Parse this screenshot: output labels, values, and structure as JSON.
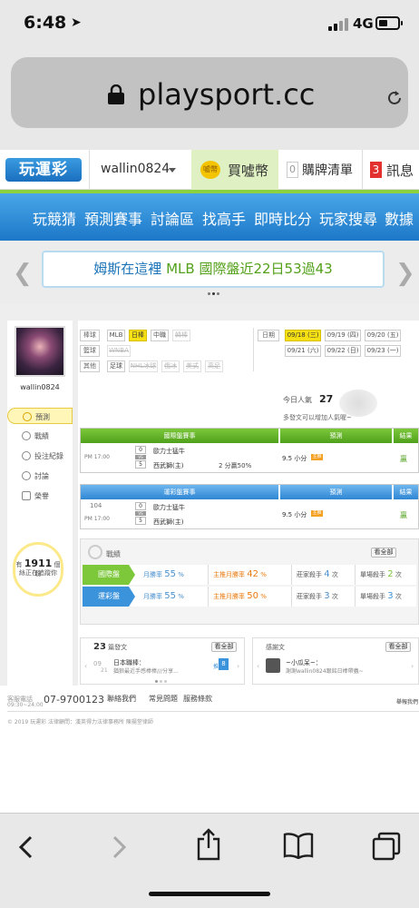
{
  "status_bar": {
    "time": "6:48",
    "network": "4G"
  },
  "address_bar": {
    "url": "playsport.cc"
  },
  "site_header": {
    "logo_text": "玩運彩",
    "username": "wallin0824",
    "buy_coins_label": "買噓幣",
    "coin_icon_text": "噓幣",
    "cart_count": "0",
    "cart_label": "購牌清單",
    "message_count": "3",
    "message_label": "訊息"
  },
  "nav": {
    "items": [
      "玩競猜",
      "預測賽事",
      "討論區",
      "找高手",
      "即時比分",
      "玩家搜尋",
      "數據"
    ]
  },
  "banner": {
    "prefix": "姆斯在這裡",
    "highlight": " MLB 國際盤近22日53過43"
  },
  "sidebar": {
    "username": "wallin0824",
    "menu": [
      "預測",
      "戰績",
      "投注紀錄",
      "討論",
      "榮譽"
    ],
    "count_prefix": "有",
    "count": "1911",
    "count_unit": "個粉",
    "count_suffix": "絲正在追蹤你"
  },
  "filters": {
    "baseball_label": "棒球",
    "baseball": [
      "MLB",
      "日棒",
      "中職",
      "韓棒"
    ],
    "basketball_label": "籃球",
    "basketball": [
      "WNBA"
    ],
    "other_label": "其他",
    "other": [
      "足球",
      "NHL冰球",
      "俄冰",
      "美式",
      "高足"
    ],
    "date_label": "日期",
    "dates_row1": [
      "09/18 (三)",
      "09/19 (四)",
      "09/20 (五)"
    ],
    "dates_row2": [
      "09/21 (六)",
      "09/22 (日)",
      "09/23 (一)"
    ]
  },
  "popularity": {
    "label": "今日人氣",
    "value": "27",
    "note": "多發文可以增加人氣喔~"
  },
  "intl_table": {
    "header_game": "國際盤賽事",
    "header_pred": "預測",
    "header_result": "結果",
    "time": "PM 17:00",
    "team1_score": "0",
    "team1": "歐力士猛牛",
    "team2_score": "5",
    "team2": "西武獅(主)",
    "vs": "VS",
    "line": "2 分贏50%",
    "prediction": "9.5 小分",
    "pred_tag": "主推",
    "result": "贏"
  },
  "lottery_table": {
    "header_game": "運彩盤賽事",
    "header_pred": "預測",
    "header_result": "結果",
    "game_no": "104",
    "time": "PM 17:00",
    "team1_score": "0",
    "team1": "歐力士猛牛",
    "team2_score": "5",
    "team2": "西武獅(主)",
    "vs": "VS",
    "prediction": "9.5 小分",
    "pred_tag": "主推",
    "result": "贏"
  },
  "record": {
    "title": "戰績",
    "more_label": "看全部",
    "rows": [
      {
        "label": "國際盤",
        "month_rate_label": "月勝率",
        "month_rate": "55",
        "main_rate_label": "主推月勝率",
        "main_rate": "42",
        "banker_label": "莊家殺手",
        "banker_count": "4",
        "single_label": "單場殺手",
        "single_count": "2",
        "color": "#7cc83a"
      },
      {
        "label": "運彩盤",
        "month_rate_label": "月勝率",
        "month_rate": "55",
        "main_rate_label": "主推月勝率",
        "main_rate": "50",
        "banker_label": "莊家殺手",
        "banker_count": "3",
        "single_label": "單場殺手",
        "single_count": "3",
        "color": "#3b93dc"
      }
    ],
    "pct": "%",
    "times": "次"
  },
  "posts": {
    "count": "23",
    "label": "篇發文",
    "more_label": "看全部",
    "date_month": "09",
    "date_day": "21",
    "post_title": "日本職棒：",
    "post_snippet": "猶狼最近手感棒棒///分享...",
    "reply_label": "推",
    "reply_count": "8"
  },
  "thanks": {
    "label": "感謝文",
    "more_label": "看全部",
    "author": "~小瓜呆~：",
    "text": "謝謝wallin0824跟銘日棒帶蟲~"
  },
  "footer": {
    "service_label": "客服電話",
    "service_hours": "09:30~24:00",
    "phone": "07-9700123",
    "links": [
      "聯絡我們",
      "常見問題",
      "服務條款"
    ],
    "report": "舉報我們",
    "copyright": "© 2019 玩運彩 法律顧問：漢英得力法律事務所 陳揚堂律師"
  },
  "colors": {
    "nav_blue": "#1c78c8",
    "accent_green": "#7cc83a",
    "highlight_yellow": "#f6e012"
  }
}
